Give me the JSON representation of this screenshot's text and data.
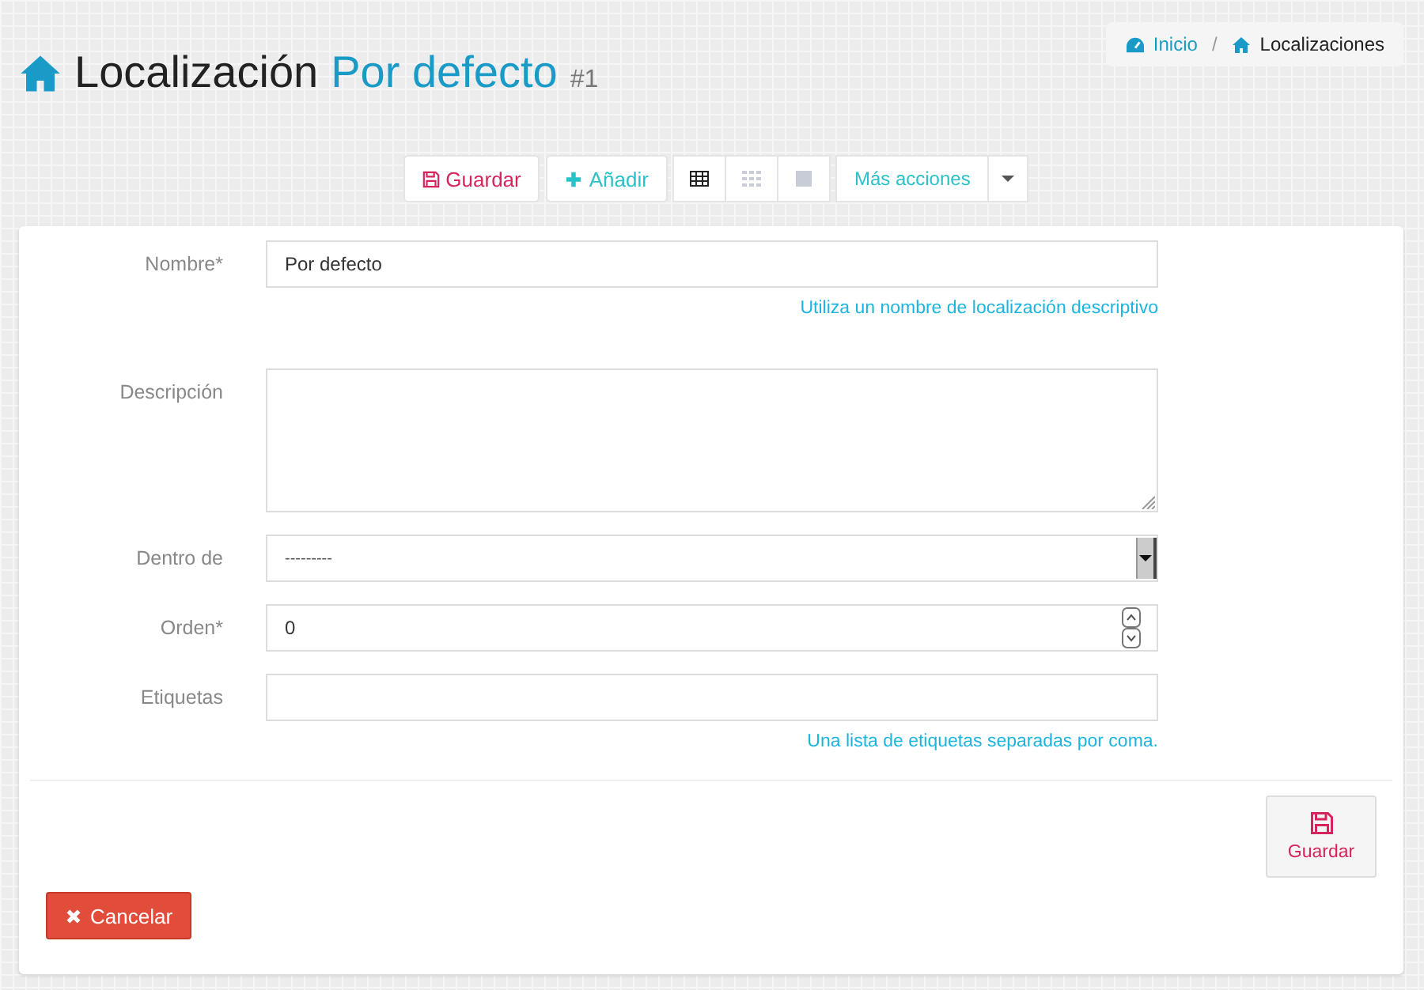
{
  "header": {
    "title": "Localización",
    "subtitle": "Por defecto",
    "id_badge": "#1"
  },
  "breadcrumb": [
    {
      "label": "Inicio",
      "kind": "dashboard",
      "link": true
    },
    {
      "label": "Localizaciones",
      "kind": "home",
      "link": false
    }
  ],
  "breadcrumb_separator": "/",
  "toolbar": {
    "save": "Guardar",
    "add": "Añadir",
    "views": [
      {
        "kind": "table",
        "selected": true
      },
      {
        "kind": "grid",
        "selected": false
      },
      {
        "kind": "single",
        "selected": false
      }
    ],
    "more": "Más acciones"
  },
  "form": {
    "fields": [
      {
        "kind": "text",
        "label": "Nombre*",
        "value": "Por defecto",
        "help": "Utiliza un nombre de localización descriptivo"
      },
      {
        "kind": "textarea",
        "label": "Descripción"
      },
      {
        "kind": "select",
        "label": "Dentro de",
        "value": "---------"
      },
      {
        "kind": "number",
        "label": "Orden*",
        "value": "0"
      },
      {
        "kind": "text",
        "label": "Etiquetas",
        "help": "Una lista de etiquetas separadas por coma."
      }
    ]
  },
  "actions": {
    "save": "Guardar",
    "cancel": "Cancelar"
  }
}
